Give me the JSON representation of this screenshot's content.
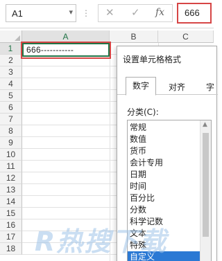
{
  "formula_bar": {
    "name_box": "A1",
    "dropdown_glyph": "▾",
    "separator_glyph": "⋮",
    "cancel_glyph": "✕",
    "enter_glyph": "✓",
    "function_glyph": "fx",
    "content": "666"
  },
  "sheet": {
    "columns": [
      "A",
      "B",
      "C"
    ],
    "rows": [
      "1",
      "2",
      "3",
      "4",
      "5",
      "6",
      "7",
      "8",
      "9",
      "10",
      "11",
      "12",
      "13",
      "14",
      "15",
      "16",
      "17",
      "18"
    ],
    "cell_a1": "666-----------",
    "selected_row": "1",
    "selected_column": "A"
  },
  "dialog": {
    "title": "设置单元格格式",
    "tabs": [
      "数字",
      "对齐",
      "字"
    ],
    "active_tab": "数字",
    "category_label": "分类(C):",
    "categories": [
      "常规",
      "数值",
      "货币",
      "会计专用",
      "日期",
      "时间",
      "百分比",
      "分数",
      "科学记数",
      "文本",
      "特殊",
      "自定义"
    ],
    "selected_category": "自定义"
  },
  "watermark": {
    "text": "R热搜下载",
    "color": "#9fc3e8"
  },
  "colors": {
    "accent_green": "#217346",
    "highlight_red": "#d64545",
    "selection_blue": "#2b79d4"
  }
}
